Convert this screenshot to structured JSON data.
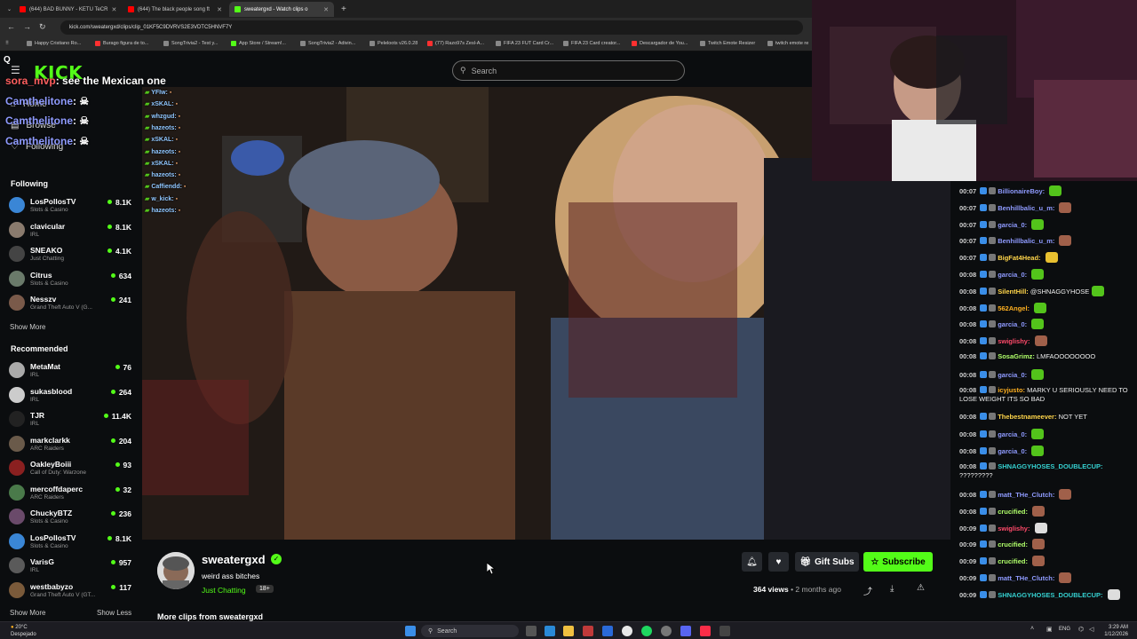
{
  "browser": {
    "tabs": [
      {
        "title": "(644) BAD BUNNY - KETU TeCR",
        "color": "#ff0000"
      },
      {
        "title": "(644) The black people song ft",
        "color": "#ff0000"
      },
      {
        "title": "sweatergxd - Watch clips o",
        "color": "#53fc18"
      }
    ],
    "url": "kick.com/sweatergxd/clips/clip_01KF5C9DVRVS2E3VDTC5HNVF7Y",
    "bookmarks": [
      "Happy Cristiano Ro...",
      "Burago figura de to...",
      "SongTrivia2 - Test y...",
      "App Store / Stream!...",
      "SongTrivia2 - Adivin...",
      "Peleloots v26.0.28",
      "(77) Razo97s Zesl-A...",
      "FIFA 23 FUT Card Cr...",
      "FIFA 23 Card creator...",
      "Descargador de You...",
      "Twitch Emote Resizer",
      "twitch emote re"
    ]
  },
  "kick": {
    "logo": "KICK",
    "search_placeholder": "Search"
  },
  "overlay_chat": [
    {
      "user": "sora_mvp",
      "text": ": see the Mexican one"
    },
    {
      "user": "Camthelitone",
      "text": ":"
    },
    {
      "user": "Camthelitone",
      "text": ":"
    },
    {
      "user": "Camthelitone",
      "text": ":"
    }
  ],
  "nav": {
    "home": "Home",
    "browse": "Browse",
    "following": "Following"
  },
  "sidebar": {
    "following_title": "Following",
    "following": [
      {
        "name": "LosPollosTV",
        "category": "Slots & Casino",
        "viewers": "8.1K",
        "color": "#3a86d6"
      },
      {
        "name": "clavicular",
        "category": "IRL",
        "viewers": "8.1K",
        "color": "#8a7b6e"
      },
      {
        "name": "SNEAKO",
        "category": "Just Chatting",
        "viewers": "4.1K",
        "color": "#444444"
      },
      {
        "name": "Citrus",
        "category": "Slots & Casino",
        "viewers": "634",
        "color": "#6a7a6a"
      },
      {
        "name": "Nesszv",
        "category": "Grand Theft Auto V (G...",
        "viewers": "241",
        "color": "#7a5a4a"
      }
    ],
    "show_more": "Show More",
    "recommended_title": "Recommended",
    "recommended": [
      {
        "name": "MetaMat",
        "category": "IRL",
        "viewers": "76",
        "color": "#aaaaaa"
      },
      {
        "name": "sukasblood",
        "category": "IRL",
        "viewers": "264",
        "color": "#cccccc"
      },
      {
        "name": "TJR",
        "category": "IRL",
        "viewers": "11.4K",
        "color": "#222222"
      },
      {
        "name": "markclarkk",
        "category": "ARC Raiders",
        "viewers": "204",
        "color": "#6a5a4a"
      },
      {
        "name": "OakleyBoiii",
        "category": "Call of Duty: Warzone",
        "viewers": "93",
        "color": "#8a2020"
      },
      {
        "name": "mercoffdaperc",
        "category": "ARC Raiders",
        "viewers": "32",
        "color": "#4a7a4a"
      },
      {
        "name": "ChuckyBTZ",
        "category": "Slots & Casino",
        "viewers": "236",
        "color": "#6a4a6a"
      },
      {
        "name": "LosPollosTV",
        "category": "Slots & Casino",
        "viewers": "8.1K",
        "color": "#3a86d6"
      },
      {
        "name": "VarisG",
        "category": "IRL",
        "viewers": "957",
        "color": "#5a5a5a"
      },
      {
        "name": "westbabyzo",
        "category": "Grand Theft Auto V (GT...",
        "viewers": "117",
        "color": "#7a5a3a"
      }
    ],
    "show_more2": "Show More",
    "show_less": "Show Less"
  },
  "video_chat": [
    {
      "user": "YFIw:"
    },
    {
      "user": "xSKAL:"
    },
    {
      "user": "whzgud:"
    },
    {
      "user": "hazeots:"
    },
    {
      "user": "xSKAL:"
    },
    {
      "user": "hazeots:"
    },
    {
      "user": "xSKAL:"
    },
    {
      "user": "hazeots:"
    },
    {
      "user": "Caffiendd:"
    },
    {
      "user": "w_kick:"
    },
    {
      "user": "hazeots:"
    }
  ],
  "chat": [
    {
      "ts": "00:07",
      "user": "BillionaireBoy:",
      "text": "",
      "color": "#8f9bff",
      "emote": "#53c41b"
    },
    {
      "ts": "00:07",
      "user": "Benhillbalic_u_m:",
      "text": "",
      "color": "#8f9bff",
      "emote": "#a0604a"
    },
    {
      "ts": "00:07",
      "user": "garcia_0:",
      "text": "",
      "color": "#8f9bff",
      "emote": "#53c41b"
    },
    {
      "ts": "00:07",
      "user": "Benhillbalic_u_m:",
      "text": "",
      "color": "#8f9bff",
      "emote": "#a0604a"
    },
    {
      "ts": "00:07",
      "user": "BigFat4Head:",
      "text": "",
      "color": "#ffd54a",
      "emote": "#e8c030"
    },
    {
      "ts": "00:08",
      "user": "garcia_0:",
      "text": "",
      "color": "#8f9bff",
      "emote": "#53c41b"
    },
    {
      "ts": "00:08",
      "user": "SilentHill:",
      "text": "@SHNAGGYHOSE",
      "color": "#ffd54a",
      "emote": "#53c41b"
    },
    {
      "ts": "00:08",
      "user": "562Angel:",
      "text": "",
      "color": "#ffb020",
      "emote": "#53c41b"
    },
    {
      "ts": "00:08",
      "user": "garcia_0:",
      "text": "",
      "color": "#8f9bff",
      "emote": "#53c41b"
    },
    {
      "ts": "00:08",
      "user": "swiglishy:",
      "text": "",
      "color": "#ff4a6a",
      "emote": "#a0604a"
    },
    {
      "ts": "00:08",
      "user": "SosaGrimz:",
      "text": "LMFAOOOOOOOO",
      "color": "#b0ff6a",
      "emote": ""
    },
    {
      "ts": "00:08",
      "user": "garcia_0:",
      "text": "",
      "color": "#8f9bff",
      "emote": "#53c41b"
    },
    {
      "ts": "00:08",
      "user": "icyjusto:",
      "text": "MARKY U SERIOUSLY NEED TO LOSE WEIGHT ITS SO BAD",
      "color": "#ffb020",
      "emote": ""
    },
    {
      "ts": "00:08",
      "user": "Thebestnameever:",
      "text": "NOT YET",
      "color": "#ffd54a",
      "emote": ""
    },
    {
      "ts": "00:08",
      "user": "garcia_0:",
      "text": "",
      "color": "#8f9bff",
      "emote": "#53c41b"
    },
    {
      "ts": "00:08",
      "user": "garcia_0:",
      "text": "",
      "color": "#8f9bff",
      "emote": "#53c41b"
    },
    {
      "ts": "00:08",
      "user": "SHNAGGYHOSES_DOUBLECUP:",
      "text": "?????????",
      "color": "#35d0d0",
      "emote": ""
    },
    {
      "ts": "00:08",
      "user": "matt_THe_Clutch:",
      "text": "",
      "color": "#8f9bff",
      "emote": "#a0604a"
    },
    {
      "ts": "00:08",
      "user": "crucified:",
      "text": "",
      "color": "#b0ff6a",
      "emote": "#a0604a"
    },
    {
      "ts": "00:09",
      "user": "swiglishy:",
      "text": "",
      "color": "#ff4a6a",
      "emote": "#dddddd"
    },
    {
      "ts": "00:09",
      "user": "crucified:",
      "text": "",
      "color": "#b0ff6a",
      "emote": "#a0604a"
    },
    {
      "ts": "00:09",
      "user": "crucified:",
      "text": "",
      "color": "#b0ff6a",
      "emote": "#a0604a"
    },
    {
      "ts": "00:09",
      "user": "matt_THe_Clutch:",
      "text": "",
      "color": "#8f9bff",
      "emote": "#a0604a"
    },
    {
      "ts": "00:09",
      "user": "SHNAGGYHOSES_DOUBLECUP:",
      "text": "",
      "color": "#35d0d0",
      "emote": "#dddddd"
    }
  ],
  "channel": {
    "name": "sweatergxd",
    "clip_title": "weird ass bitches",
    "category": "Just Chatting",
    "age_badge": "18+",
    "views": "364 views",
    "posted": "• 2 months ago",
    "gift_label": "Gift Subs",
    "subscribe_label": "Subscribe",
    "more_clips": "More clips from sweatergxd"
  },
  "taskbar": {
    "weather_temp": "20°C",
    "weather_desc": "Despejado",
    "search": "Search",
    "lang": "ENG",
    "time": "3:29 AM",
    "date": "1/12/2026"
  },
  "colors": {
    "kick_green": "#53fc18",
    "bg": "#0b0d0f"
  }
}
